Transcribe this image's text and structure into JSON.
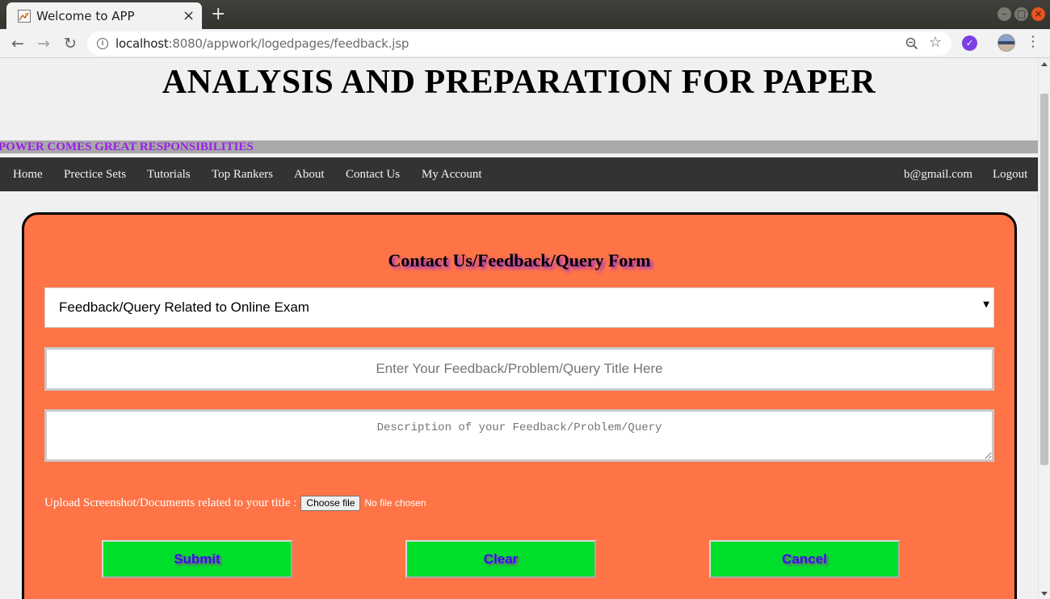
{
  "browser": {
    "tab_title": "Welcome to APP",
    "tab_close": "×",
    "new_tab": "+",
    "url_host": "localhost",
    "url_rest": ":8080/appwork/logedpages/feedback.jsp",
    "back": "←",
    "forward": "→",
    "reload": "↻",
    "bookmark_star": "☆",
    "menu": "⋮",
    "window_minimize": "–",
    "window_maximize": "□",
    "window_close": "×"
  },
  "header": {
    "site_title": "ANALYSIS AND PREPARATION FOR PAPER",
    "marquee": "POWER COMES GREAT RESPONSIBILITIES"
  },
  "nav": {
    "items": [
      "Home",
      "Prectice Sets",
      "Tutorials",
      "Top Rankers",
      "About",
      "Contact Us",
      "My Account"
    ],
    "user_email": "b@gmail.com",
    "logout": "Logout"
  },
  "form": {
    "heading": "Contact Us/Feedback/Query Form",
    "select_value": "Feedback/Query Related to Online Exam",
    "select_arrow": "▼",
    "title_placeholder": "Enter Your Feedback/Problem/Query Title Here",
    "title_value": "",
    "description_placeholder": "Description of your Feedback/Problem/Query",
    "description_value": "",
    "upload_label": "Upload Screenshot/Documents related to your title :",
    "choose_file": "Choose file",
    "file_status": "No file chosen",
    "submit": "Submit",
    "clear": "Clear",
    "cancel": "Cancel"
  },
  "colors": {
    "form_background": "#ff7446",
    "button_background": "#00e02a",
    "button_text": "#3c0cf0",
    "marquee_text": "#9b1fe8",
    "navbar_background": "#333333"
  }
}
